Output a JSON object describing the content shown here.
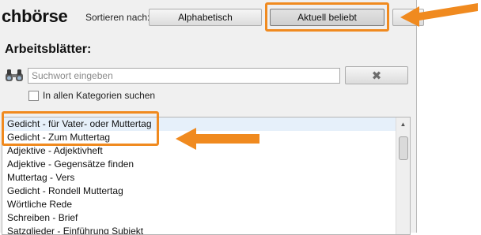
{
  "header": {
    "title": "chbörse",
    "sort_label": "Sortieren nach:",
    "sort_alpha_label": "Alphabetisch",
    "sort_popular_label": "Aktuell beliebt"
  },
  "worksheets": {
    "title": "Arbeitsblätter:",
    "search_placeholder": "Suchwort eingeben",
    "clear_icon_glyph": "✖",
    "all_categories_label": "In allen Kategorien suchen",
    "all_categories_checked": false
  },
  "list": {
    "items": [
      "Gedicht - für Vater- oder Muttertag",
      "Gedicht - Zum Muttertag",
      "Adjektive - Adjektivheft",
      "Adjektive - Gegensätze finden",
      "Muttertag - Vers",
      "Gedicht - Rondell Muttertag",
      "Wörtliche Rede",
      "Schreiben - Brief",
      "Satzglieder - Einführung Subjekt"
    ],
    "scroll_up_glyph": "▲"
  },
  "colors": {
    "highlight": "#f08a1f",
    "panel_bg": "#f0f0f0",
    "selection_bg": "#e6f0fa"
  }
}
